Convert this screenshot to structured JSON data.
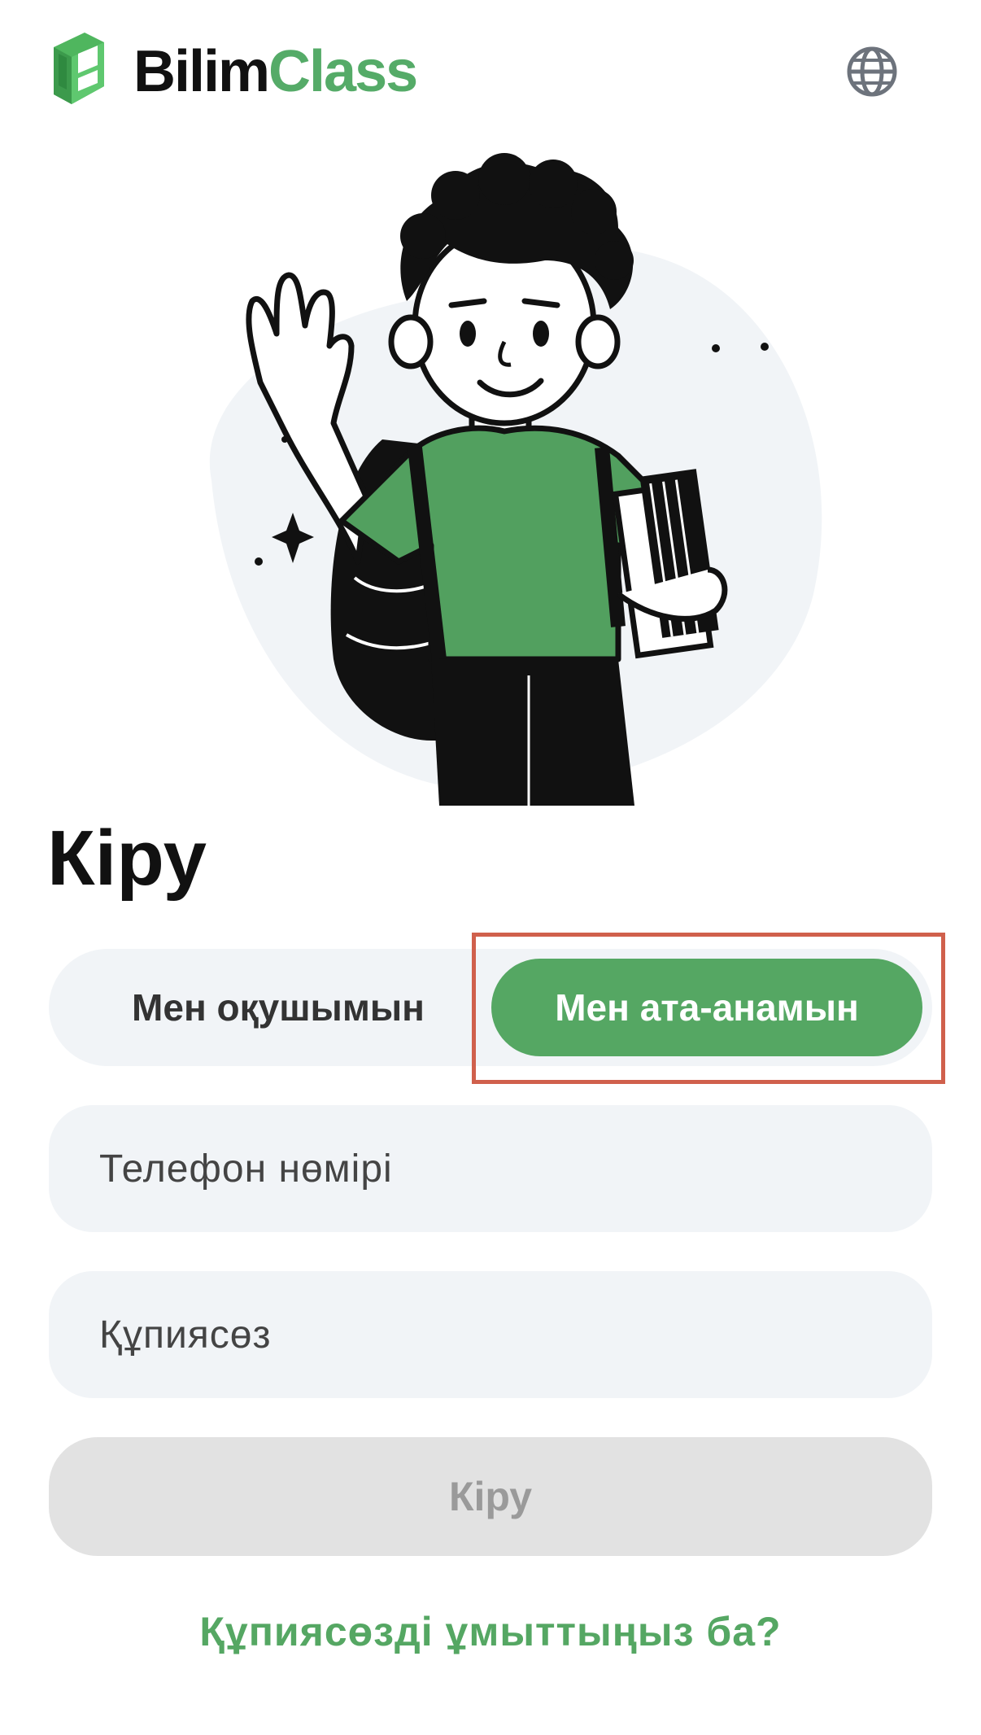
{
  "header": {
    "logo_part1": "Bilim",
    "logo_part2": "Class",
    "language_icon": "globe-icon"
  },
  "illustration": {
    "icon": "student-waving-illustration"
  },
  "login": {
    "title": "Кіру",
    "roles": [
      {
        "label": "Мен оқушымын",
        "selected": false
      },
      {
        "label": "Мен ата-анамын",
        "selected": true
      }
    ],
    "phone": {
      "placeholder": "Телефон нөмірі",
      "value": ""
    },
    "password": {
      "placeholder": "Құпиясөз",
      "value": ""
    },
    "submit_label": "Кіру",
    "forgot_label": "Құпиясөзді ұмыттыңыз ба?"
  },
  "colors": {
    "brand_green": "#55a763",
    "highlight": "#d0604c",
    "field_bg": "#f1f4f7",
    "disabled_button": "#e2e2e2"
  }
}
